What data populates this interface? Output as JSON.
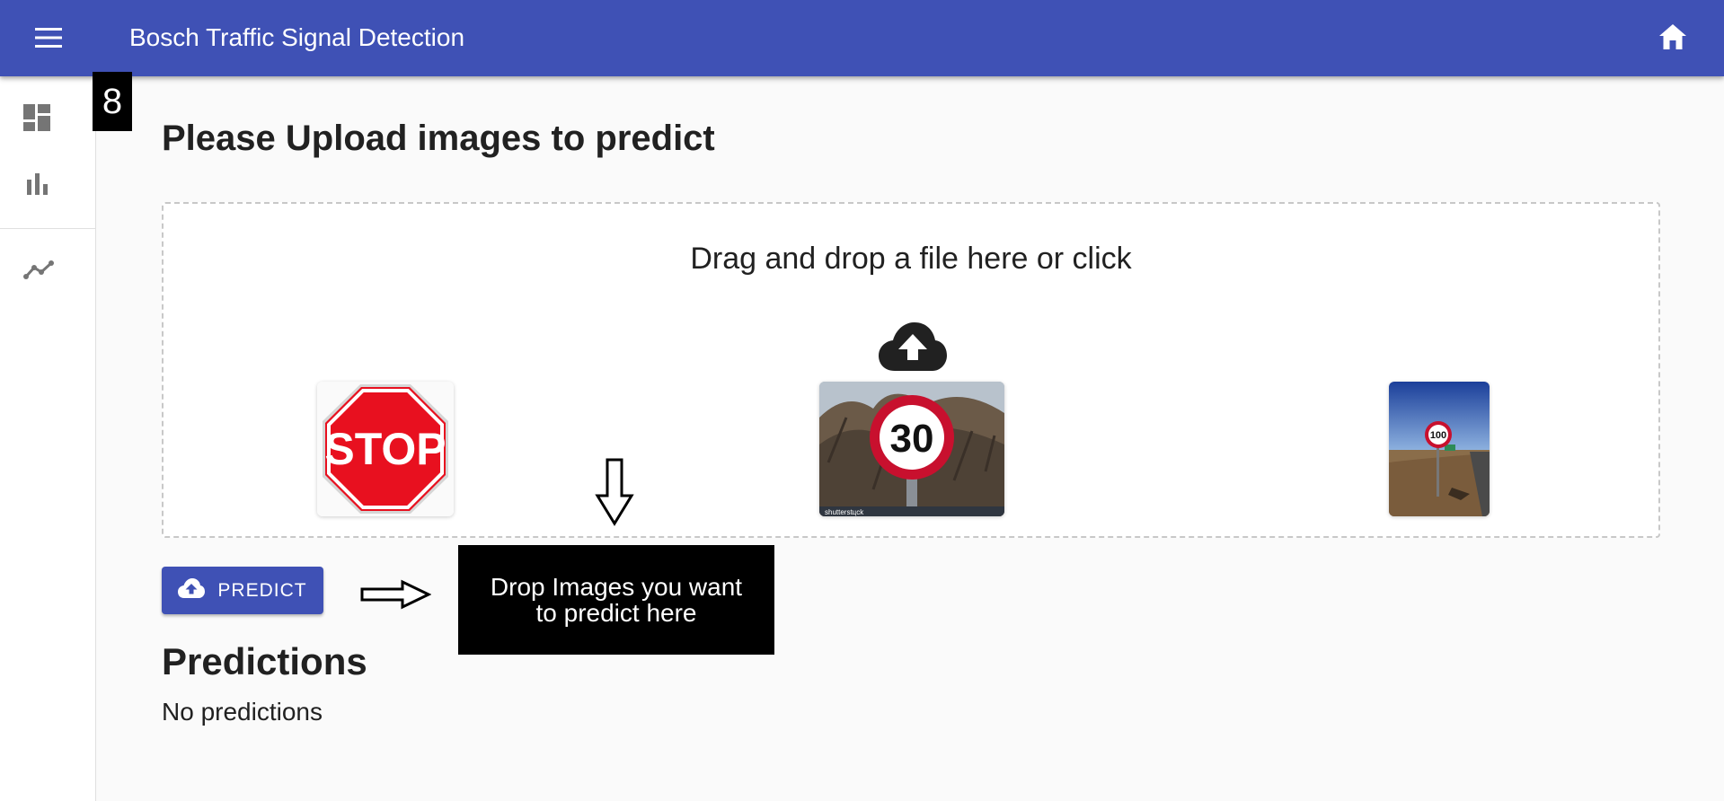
{
  "appbar": {
    "title": "Bosch Traffic Signal Detection",
    "menu_icon": "menu-icon",
    "home_icon": "home-icon",
    "color": "#3f51b5"
  },
  "sidebar": {
    "items": [
      {
        "icon": "dashboard-icon"
      },
      {
        "icon": "bar-chart-icon"
      },
      {
        "icon": "timeline-icon"
      }
    ]
  },
  "step_badge": "8",
  "main": {
    "title": "Please Upload images to predict",
    "dropzone": {
      "text": "Drag and drop a file here or click",
      "icon": "cloud-upload-icon",
      "thumbnails": [
        {
          "name": "stop-sign-image",
          "sign_text": "STOP"
        },
        {
          "name": "speed-limit-30-image",
          "sign_text": "30",
          "watermark": "shutterstцck"
        },
        {
          "name": "speed-limit-100-image",
          "sign_text": "100"
        }
      ]
    },
    "predict_button": {
      "label": "PREDICT",
      "icon": "cloud-upload-icon"
    },
    "annotation": "Drop Images you want to predict here",
    "predictions": {
      "title": "Predictions",
      "empty_text": "No predictions"
    }
  }
}
